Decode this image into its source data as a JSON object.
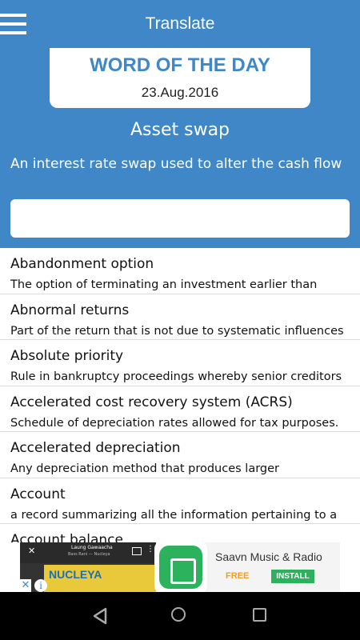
{
  "header": {
    "title": "Translate",
    "menu_icon": "hamburger-menu-icon"
  },
  "word_of_the_day": {
    "label": "WORD OF THE DAY",
    "date": "23.Aug.2016",
    "word": "Asset swap",
    "definition": "An interest rate swap used to alter the cash flow"
  },
  "search": {
    "value": "",
    "placeholder": ""
  },
  "terms": [
    {
      "term": "Abandonment option",
      "definition": "The option of terminating an investment earlier than"
    },
    {
      "term": "Abnormal returns",
      "definition": "Part of the return that is not due to systematic influences"
    },
    {
      "term": "Absolute priority",
      "definition": "Rule in bankruptcy proceedings whereby senior creditors"
    },
    {
      "term": "Accelerated cost recovery system (ACRS)",
      "definition": "Schedule of depreciation rates allowed for tax purposes."
    },
    {
      "term": "Accelerated depreciation",
      "definition": "Any depreciation method that produces larger"
    },
    {
      "term": "Account",
      "definition": "a record summarizing all the information pertaining to a"
    },
    {
      "term": "Account balance",
      "definition": ""
    }
  ],
  "ad": {
    "video_song": "Laung Gawaacha",
    "video_artist": "Bass Rani — Nucleya",
    "video_art_text": "NUCLEYA",
    "app_name": "Saavn Music & Radio",
    "price": "FREE",
    "install_label": "INSTALL"
  },
  "colors": {
    "primary": "#3f87c6",
    "install_green": "#2cb15d",
    "free_orange": "#f0a020"
  }
}
